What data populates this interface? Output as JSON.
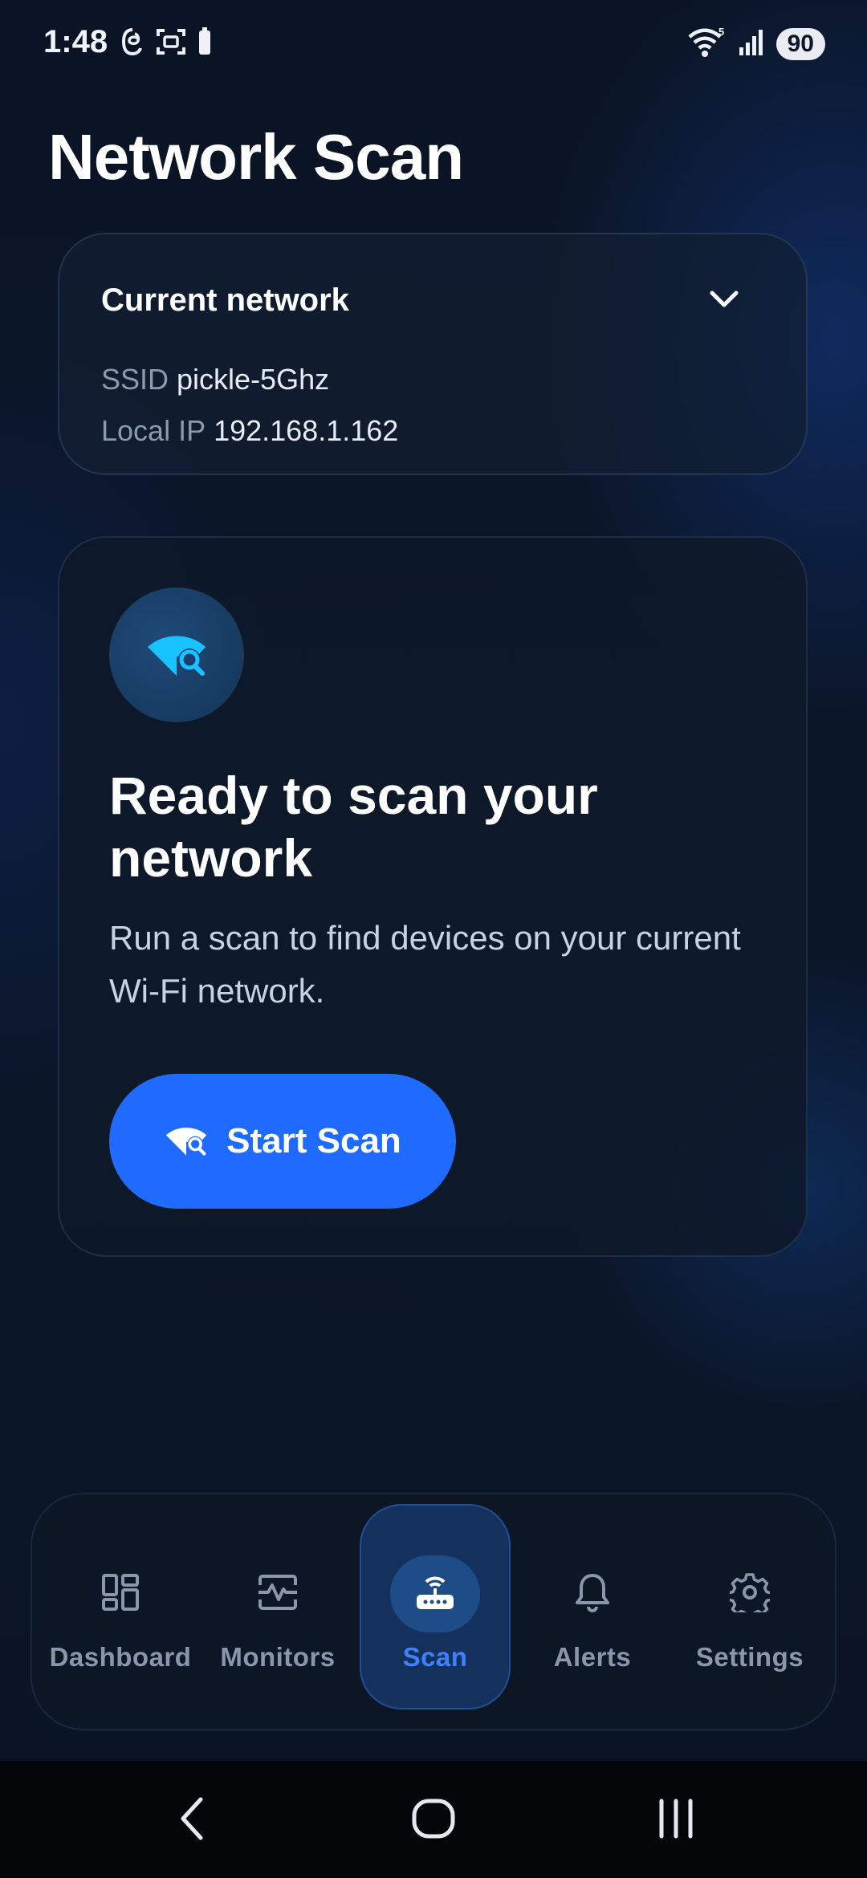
{
  "status_bar": {
    "time": "1:48",
    "battery": "90",
    "wifi_badge": "5"
  },
  "page": {
    "title": "Network Scan"
  },
  "network_card": {
    "title": "Current network",
    "ssid_label": "SSID",
    "ssid_value": "pickle-5Ghz",
    "ip_label": "Local IP",
    "ip_value": "192.168.1.162"
  },
  "scan_card": {
    "heading": "Ready to scan your network",
    "description": "Run a scan to find devices on your current Wi-Fi network.",
    "button_label": "Start Scan",
    "icon": "wifi-scan-icon"
  },
  "bottom_nav": {
    "active": "Scan",
    "items": [
      {
        "label": "Dashboard",
        "icon": "dashboard-icon"
      },
      {
        "label": "Monitors",
        "icon": "monitor-pulse-icon"
      },
      {
        "label": "Scan",
        "icon": "router-icon"
      },
      {
        "label": "Alerts",
        "icon": "bell-icon"
      },
      {
        "label": "Settings",
        "icon": "gear-icon"
      }
    ]
  },
  "colors": {
    "accent": "#1f6bff",
    "active_label": "#3b82ff",
    "scan_icon": "#19c3ff",
    "background": "#0b1628"
  }
}
